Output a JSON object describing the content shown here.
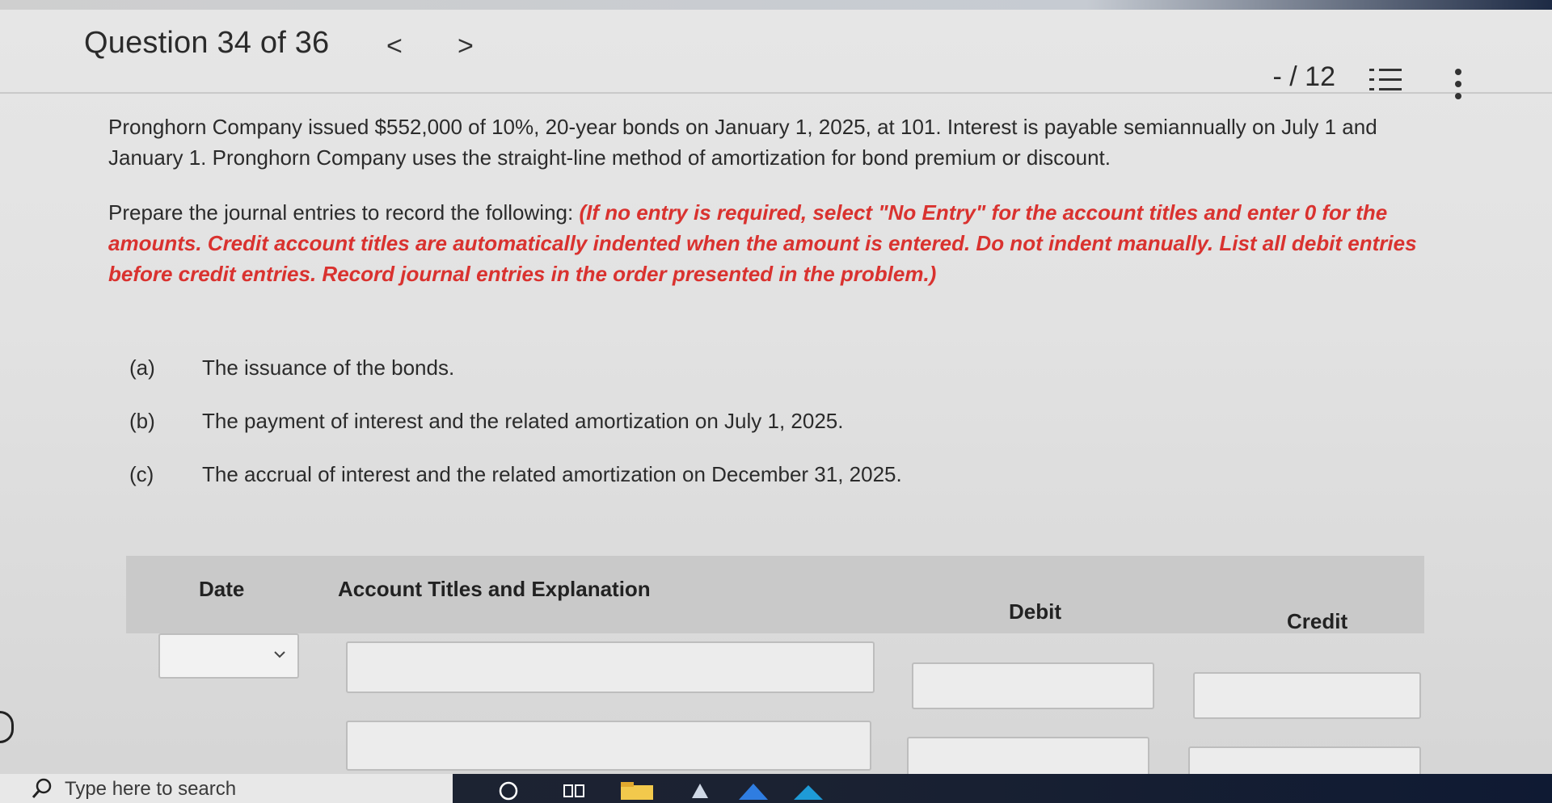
{
  "header": {
    "question_label": "Question 34 of 36",
    "prev_glyph": "<",
    "next_glyph": ">",
    "score": "- / 12",
    "list_icon": "numbered-list-icon",
    "more_icon": "vertical-ellipsis-icon"
  },
  "problem": {
    "statement": "Pronghorn Company issued $552,000 of 10%, 20-year bonds on January 1, 2025, at 101. Interest is payable semiannually on July 1 and January 1. Pronghorn Company uses the straight-line method of amortization for bond premium or discount.",
    "instruction_lead": "Prepare the journal entries to record the following: ",
    "instruction_note": "(If no entry is required, select \"No Entry\" for the account titles and enter 0 for the amounts. Credit account titles are automatically indented when the amount is entered. Do not indent manually. List all debit entries before credit entries. Record journal entries in the order presented in the problem.)"
  },
  "items": [
    {
      "letter": "(a)",
      "text": "The issuance of the bonds."
    },
    {
      "letter": "(b)",
      "text": "The payment of interest and the related amortization on July 1, 2025."
    },
    {
      "letter": "(c)",
      "text": "The accrual of interest and the related amortization on December 31, 2025."
    }
  ],
  "journal_table": {
    "headers": {
      "date": "Date",
      "account": "Account Titles and Explanation",
      "debit": "Debit",
      "credit": "Credit"
    },
    "rows": [
      {
        "date": "",
        "account": "",
        "debit": "",
        "credit": ""
      },
      {
        "account": "",
        "debit": "",
        "credit": ""
      }
    ]
  },
  "taskbar": {
    "search_placeholder": "Type here to search",
    "colors": {
      "bar": "#1e2433",
      "search_bg": "#e8e8e8"
    }
  },
  "colors": {
    "instruction_red": "#d9322f",
    "text": "#2b2b2b",
    "table_header_bg": "#c9c9c9"
  }
}
